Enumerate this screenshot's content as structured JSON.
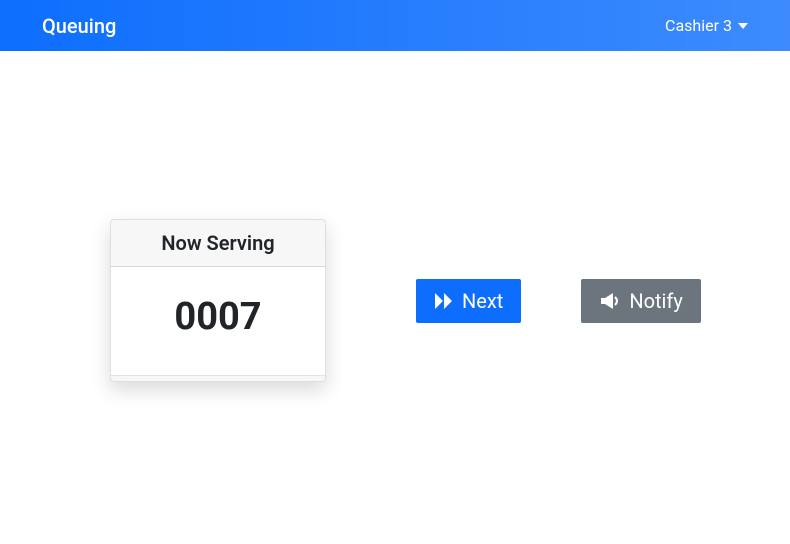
{
  "navbar": {
    "brand": "Queuing",
    "user": "Cashier 3"
  },
  "card": {
    "header": "Now Serving",
    "number": "0007"
  },
  "buttons": {
    "next": "Next",
    "notify": "Notify"
  }
}
